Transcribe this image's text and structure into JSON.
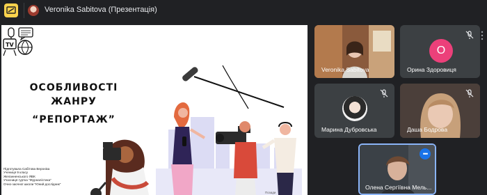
{
  "topbar": {
    "presenter_title": "Veronika Sabitova (Презентація)",
    "present_icon": "present-screen-icon",
    "accent": "#fcd34d"
  },
  "slide": {
    "title_line1": "ОСОБЛИВОСТІ ЖАНРУ",
    "title_line2": "“РЕПОРТАЖ”",
    "credits": [
      "Підготувала Сабітова Вероніка",
      "Учениця 9 класу",
      "Желанненського ЯВК",
      "Учасниця гуртка \"Журналістика\"",
      "Очно-заочної школи \"Юний дослідник\""
    ],
    "footer": "Позади",
    "icons": [
      "tv-icon",
      "speech-bubble-icon",
      "globe-icon",
      "microphone-icon",
      "video-camera-icon",
      "boom-mic-icon"
    ]
  },
  "participants": [
    {
      "name": "Veronika Sabitova",
      "muted": false,
      "kind": "video"
    },
    {
      "name": "Орина Здоровиця",
      "muted": true,
      "kind": "letter",
      "initial": "О",
      "color": "#ec407a"
    },
    {
      "name": "Марина Дубровська",
      "muted": true,
      "kind": "photo"
    },
    {
      "name": "Даша Бодрова",
      "muted": true,
      "kind": "video"
    },
    {
      "name": "Олена Сергіївна Мель...",
      "muted": false,
      "kind": "video",
      "speaking": true
    }
  ],
  "colors": {
    "background": "#202124",
    "tile": "#3c4043",
    "speaking_border": "#8ab4f8",
    "menu_button": "#1a73e8"
  }
}
